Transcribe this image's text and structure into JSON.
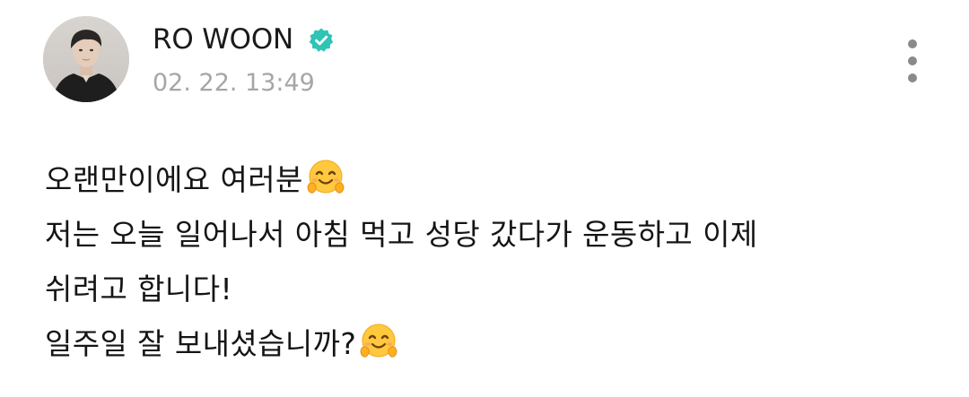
{
  "post": {
    "author": {
      "name": "RO WOON",
      "verified": true,
      "avatar_icon": "profile-photo",
      "verified_icon": "verified-badge-icon"
    },
    "timestamp": "02. 22. 13:49",
    "menu_icon": "more-vertical-icon",
    "lines": [
      "오랜만이에요 여러분",
      "저는 오늘 일어나서 아침 먹고 성당 갔다가 운동하고 이제",
      "쉬려고 합니다!",
      "일주일 잘 보내셨습니까?"
    ],
    "emoji_icon": "hugging-face-icon"
  },
  "colors": {
    "verified_badge": "#2ec4b6",
    "timestamp": "#a6a6a6",
    "menu_dots": "#8a8a8a",
    "text": "#151515"
  }
}
